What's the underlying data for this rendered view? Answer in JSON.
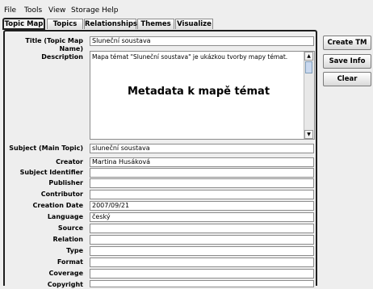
{
  "menu": [
    "File",
    "Tools",
    "View",
    "Storage",
    "Help"
  ],
  "tabs": [
    "Topic Map",
    "Topics",
    "Relationships",
    "Themes",
    "Visualize"
  ],
  "form": {
    "title_label": "Title (Topic Map Name)",
    "title_value": "Sluneční soustava",
    "description_label": "Description",
    "description_value": "Mapa témat \"Sluneční soustava\" je ukázkou tvorby mapy témat.",
    "overlay_text": "Metadata k mapě témat",
    "subject_label": "Subject (Main Topic)",
    "subject_value": "sluneční soustava",
    "fields": [
      {
        "label": "Creator",
        "value": "Martina Husáková"
      },
      {
        "label": "Subject Identifier",
        "value": ""
      },
      {
        "label": "Publisher",
        "value": ""
      },
      {
        "label": "Contributor",
        "value": ""
      },
      {
        "label": "Creation Date",
        "value": "2007/09/21"
      },
      {
        "label": "Language",
        "value": "český"
      },
      {
        "label": "Source",
        "value": ""
      },
      {
        "label": "Relation",
        "value": ""
      },
      {
        "label": "Type",
        "value": ""
      },
      {
        "label": "Format",
        "value": ""
      },
      {
        "label": "Coverage",
        "value": ""
      },
      {
        "label": "Copyright",
        "value": ""
      }
    ]
  },
  "buttons": {
    "create": "Create TM",
    "save": "Save Info",
    "clear": "Clear"
  },
  "icons": {
    "scroll_up": "scroll-up-icon",
    "scroll_down": "scroll-down-icon"
  }
}
